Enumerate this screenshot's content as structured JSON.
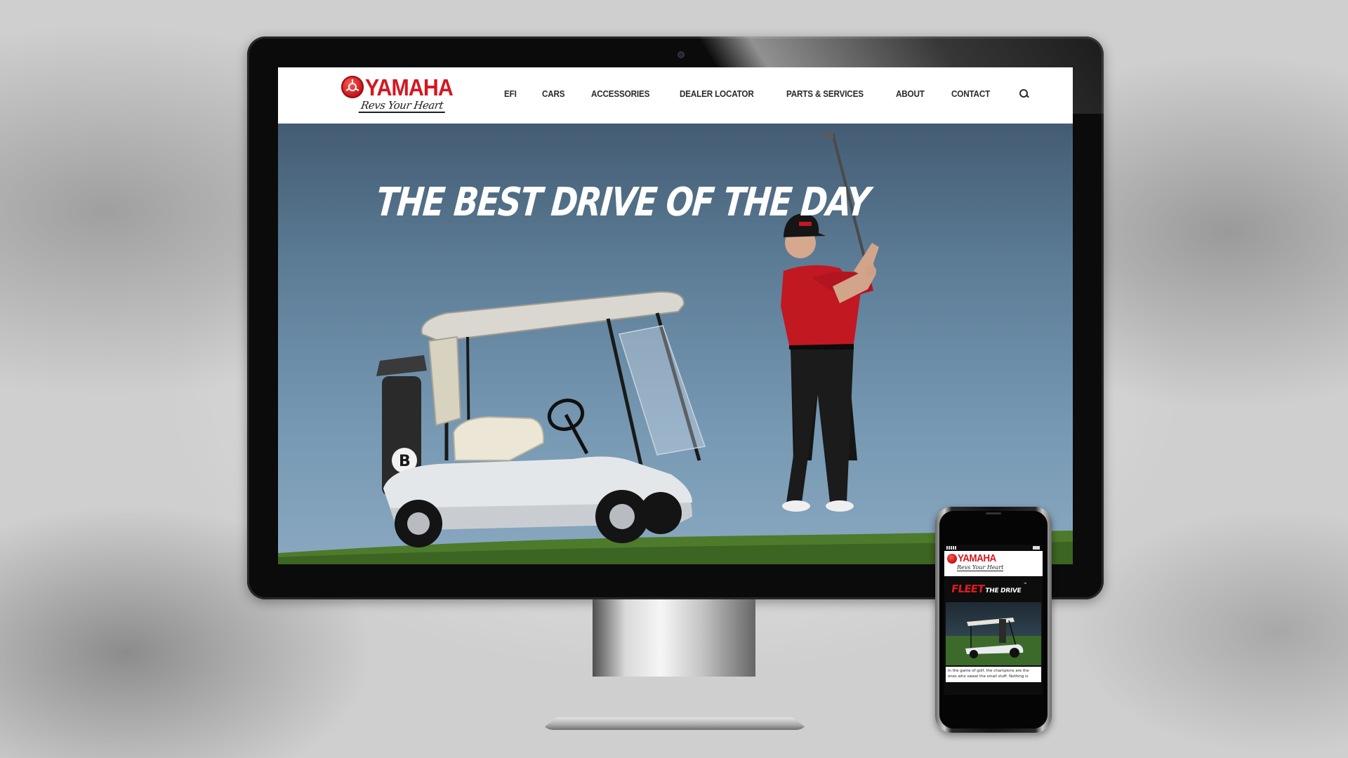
{
  "site": {
    "brand": "YAMAHA",
    "tagline": "Revs Your Heart",
    "nav": [
      {
        "label": "EFI"
      },
      {
        "label": "CARS"
      },
      {
        "label": "ACCESSORIES"
      },
      {
        "label": "DEALER LOCATOR"
      },
      {
        "label": "PARTS & SERVICES"
      },
      {
        "label": "ABOUT"
      },
      {
        "label": "CONTACT"
      }
    ],
    "search_icon": "search-icon",
    "hero": {
      "headline": "THE BEST DRIVE OF THE DAY"
    }
  },
  "mobile": {
    "brand": "YAMAHA",
    "tagline": "Revs Your Heart",
    "hero_word": "FLEET",
    "hero_sub": "THE DRIVE",
    "hero_mark": "™",
    "body_text": "In the game of golf, the champions are the ones who sweat the small stuff. Nothing is"
  },
  "colors": {
    "brand_red": "#d4171f",
    "sky": "#6f8fa9",
    "grass": "#4e7a2c"
  }
}
